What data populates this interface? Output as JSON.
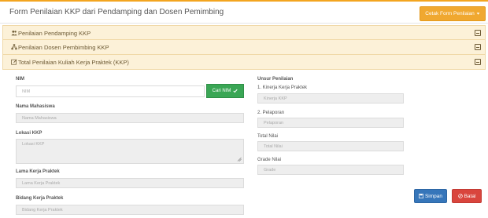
{
  "header": {
    "title": "Form Penilaian KKP dari Pendamping dan Dosen Pemimbing",
    "print_button": "Cetak Form Penilaian",
    "print_icon": "caret-down-icon"
  },
  "panels": [
    {
      "label": "Penilaian Pendamping KKP",
      "icon": "users-icon"
    },
    {
      "label": "Penilaian Dosen Pembimbing KKP",
      "icon": "sitemap-icon"
    },
    {
      "label": "Total Penilaian Kuliah Kerja Praktek (KKP)",
      "icon": "edit-icon"
    }
  ],
  "form": {
    "nim": {
      "label": "NIM",
      "placeholder": "NIM"
    },
    "cari_button": "Cari NIM",
    "nama": {
      "label": "Nama Mahasiswa",
      "placeholder": "Nama Mahasiswa"
    },
    "lokasi": {
      "label": "Lokasi KKP",
      "placeholder": "Lokasi KKP"
    },
    "lama": {
      "label": "Lama Kerja Praktek",
      "placeholder": "Lama Kerja Praktek"
    },
    "bidang": {
      "label": "Bidang Kerja Praktek",
      "placeholder": "Bidang Kerja Praktek"
    }
  },
  "scores": {
    "heading": "Unsur Penilaian",
    "kinerja": {
      "label": "1. Kinerja Kerja Praktek",
      "placeholder": "Kinerja KKP"
    },
    "pelaporan": {
      "label": "2. Pelaporan",
      "placeholder": "Pelaporan"
    },
    "total": {
      "label": "Total Nilai",
      "placeholder": "Total Nilai"
    },
    "grade": {
      "label": "Grade Nilai",
      "placeholder": "Grade"
    }
  },
  "actions": {
    "save": "Simpan",
    "cancel": "Batal"
  },
  "colors": {
    "accent": "#f0a830",
    "panel_bg": "#fcf1d8",
    "success": "#3aa655",
    "primary": "#3676ba",
    "danger": "#d9453d"
  }
}
